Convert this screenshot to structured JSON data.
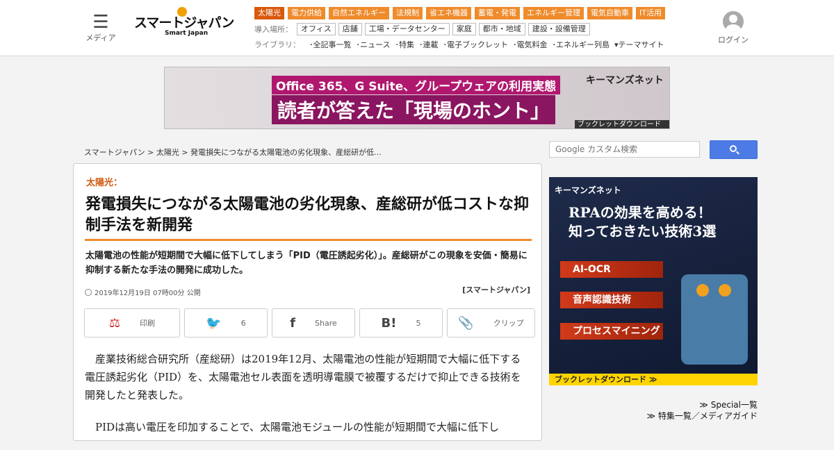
{
  "header": {
    "menu_label": "メディア",
    "logo_main": "スマートジャパン",
    "logo_sub": "Smart Japan",
    "categories": [
      "太陽光",
      "電力供給",
      "自然エネルギー",
      "法規制",
      "省エネ機器",
      "蓄電・発電",
      "エネルギー管理",
      "電気自動車",
      "IT活用"
    ],
    "places_label": "導入場所：",
    "places": [
      "オフィス",
      "店舗",
      "工場・データセンター",
      "家庭",
      "都市・地域",
      "建設・設備管理"
    ],
    "library_label": "ライブラリ：",
    "library": [
      "･全記事一覧",
      "･ニュース",
      "･特集",
      "･連載",
      "･電子ブックレット",
      "･電気料金",
      "･エネルギー列島",
      "▾テーマサイト"
    ],
    "login_label": "ログイン"
  },
  "banner": {
    "line1": "Office 365、G Suite、グループウェアの利用実態",
    "line2": "読者が答えた「現場のホント」",
    "brand": "キーマンズネット",
    "download": "ブックレットダウンロード>>"
  },
  "breadcrumb": {
    "items": [
      "スマートジャパン",
      "太陽光",
      "発電損失につながる太陽電池の劣化現象、産総研が低..."
    ],
    "separator": " > "
  },
  "search": {
    "placeholder": "Google カスタム検索"
  },
  "article": {
    "category": "太陽光：",
    "title": "発電損失につながる太陽電池の劣化現象、産総研が低コストな抑制手法を新開発",
    "lead": "太陽電池の性能が短期間で大幅に低下してしまう「PID（電圧誘起劣化）」。産総研がこの現象を安価・簡易に抑制する新たな手法の開発に成功した。",
    "date": "2019年12月19日 07時00分 公開",
    "source": "[スマートジャパン]",
    "share": {
      "print_label": "印刷",
      "twitter_count": "6",
      "facebook_label": "Share",
      "hatena_count": "5",
      "clip_label": "クリップ"
    },
    "paragraphs": [
      "産業技術総合研究所（産総研）は2019年12月、太陽電池の性能が短期間で大幅に低下する電圧誘起劣化（PID）を、太陽電池セル表面を透明導電膜で被覆するだけで抑止できる技術を開発したと発表した。",
      "PIDは高い電圧を印加することで、太陽電池モジュールの性能が短期間で大幅に低下し"
    ]
  },
  "side_ad": {
    "brand": "キーマンズネット",
    "headline1": "RPAの効果を高める！",
    "headline2": "知っておきたい技術3選",
    "pills": [
      "AI-OCR",
      "音声認識技術",
      "プロセスマイニング"
    ],
    "download": "ブックレットダウンロード ≫"
  },
  "side_links": [
    "≫ Special一覧",
    "≫ 特集一覧／メディアガイド"
  ],
  "colors": {
    "accent_orange": "#ef8b2c",
    "category_active": "#d9580c",
    "search_blue": "#4d7be5"
  }
}
